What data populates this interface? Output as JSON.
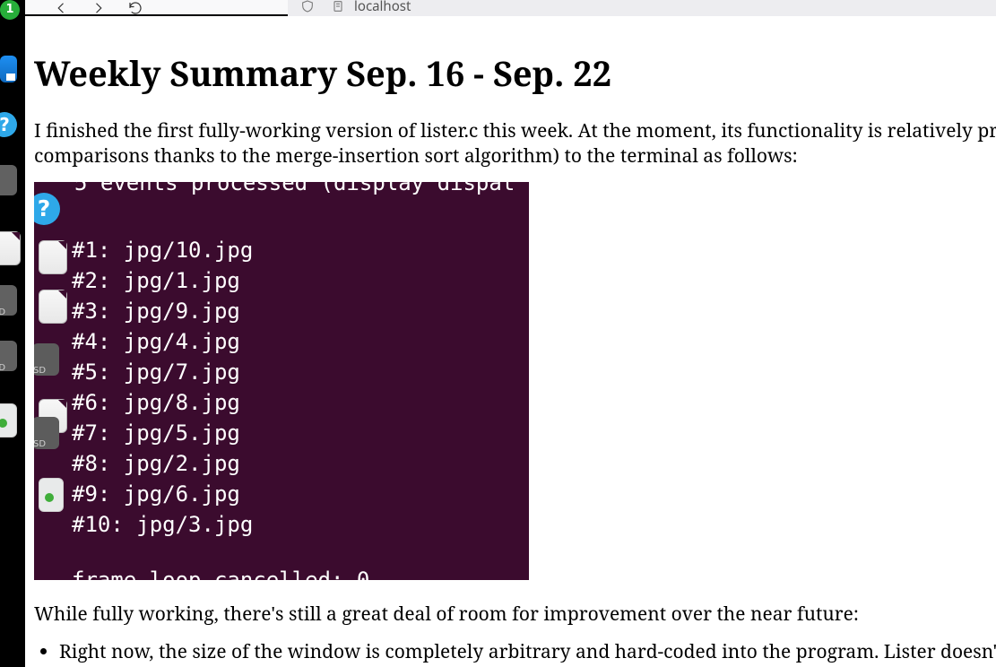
{
  "browser": {
    "url": "localhost",
    "notification_count": "1"
  },
  "page": {
    "title": "Weekly Summary Sep. 16 - Sep. 22",
    "p1": "I finished the first fully-working version of lister.c this week. At the moment, its functionality is relatively primitive",
    "p1b": "comparisons thanks to the merge-insertion sort algorithm) to the terminal as follows:",
    "p2": "While fully working, there's still a great deal of room for improvement over the near future:",
    "li1": "Right now, the size of the window is completely arbitrary and hard-coded into the program. Lister doesn't d"
  },
  "terminal": {
    "top_fragment": "5 events processed (display dispat",
    "lines": [
      "#1: jpg/10.jpg",
      "#2: jpg/1.jpg",
      "#3: jpg/9.jpg",
      "#4: jpg/4.jpg",
      "#5: jpg/7.jpg",
      "#6: jpg/8.jpg",
      "#7: jpg/5.jpg",
      "#8: jpg/2.jpg",
      "#9: jpg/6.jpg",
      "#10: jpg/3.jpg"
    ],
    "bottom_fragment": "frame loop cancelled: 0"
  },
  "desktop": {
    "sd_label": "SD"
  }
}
